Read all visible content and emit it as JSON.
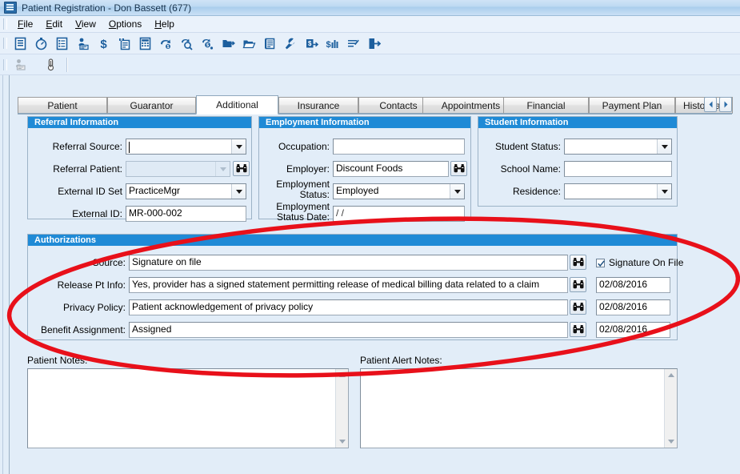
{
  "window": {
    "title": "Patient Registration - Don Bassett (677)",
    "icon": "app-window-icon"
  },
  "menu": {
    "items": [
      {
        "label": "File",
        "accel": "F"
      },
      {
        "label": "Edit",
        "accel": "E"
      },
      {
        "label": "View",
        "accel": "V"
      },
      {
        "label": "Options",
        "accel": "O"
      },
      {
        "label": "Help",
        "accel": "H"
      }
    ]
  },
  "toolbar_primary": {
    "buttons": [
      {
        "icon": "list-document-icon",
        "name": "patient-registration"
      },
      {
        "icon": "stopwatch-icon",
        "name": "timer"
      },
      {
        "icon": "checklist-icon",
        "name": "checklist"
      },
      {
        "icon": "patient-card-icon",
        "name": "patient-card"
      },
      {
        "icon": "dollar-icon",
        "name": "charges"
      },
      {
        "icon": "payment-document-icon",
        "name": "payments"
      },
      {
        "icon": "calculator-icon",
        "name": "calculator"
      },
      {
        "icon": "claim-arrow-icon",
        "name": "claims"
      },
      {
        "icon": "claim-search-icon",
        "name": "claim-search"
      },
      {
        "icon": "refund-icon",
        "name": "refund"
      },
      {
        "icon": "folder-out-icon",
        "name": "export-folder"
      },
      {
        "icon": "folder-open-icon",
        "name": "open-folder"
      },
      {
        "icon": "statement-icon",
        "name": "statement"
      },
      {
        "icon": "wrench-icon",
        "name": "tools"
      },
      {
        "icon": "transfer-balance-icon",
        "name": "transfer-balance"
      },
      {
        "icon": "dollar-chart-icon",
        "name": "reports"
      },
      {
        "icon": "edit-list-icon",
        "name": "edit-list"
      },
      {
        "icon": "exit-icon",
        "name": "exit"
      }
    ]
  },
  "toolbar_secondary": {
    "buttons": [
      {
        "icon": "patient-card-disabled-icon",
        "name": "patient-card-disabled"
      },
      {
        "icon": "thermometer-icon",
        "name": "vitals"
      }
    ]
  },
  "tabs": {
    "items": [
      {
        "label": "Patient",
        "active": false
      },
      {
        "label": "Guarantor",
        "active": false
      },
      {
        "label": "Additional",
        "active": true
      },
      {
        "label": "Insurance",
        "active": false
      },
      {
        "label": "Contacts",
        "active": false
      },
      {
        "label": "Appointments",
        "active": false
      },
      {
        "label": "Financial",
        "active": false
      },
      {
        "label": "Payment Plan",
        "active": false
      },
      {
        "label": "Historical D",
        "active": false
      }
    ],
    "nav_prev": "scroll-tabs-left",
    "nav_next": "scroll-tabs-right"
  },
  "referral_information": {
    "title": "Referral Information",
    "fields": {
      "referral_source": {
        "label": "Referral Source:",
        "value": "",
        "type": "combo"
      },
      "referral_patient": {
        "label": "Referral Patient:",
        "value": "",
        "type": "combo-disabled"
      },
      "external_id_set": {
        "label": "External ID Set",
        "value": "PracticeMgr",
        "type": "combo"
      },
      "external_id": {
        "label": "External ID:",
        "value": "MR-000-002",
        "type": "text"
      }
    }
  },
  "employment_information": {
    "title": "Employment Information",
    "fields": {
      "occupation": {
        "label": "Occupation:",
        "value": "",
        "type": "text"
      },
      "employer": {
        "label": "Employer:",
        "value": "Discount Foods",
        "type": "text-lookup"
      },
      "employment_status": {
        "label": "Employment Status:",
        "value": "Employed",
        "type": "combo"
      },
      "employment_status_date": {
        "label": "Employment Status Date:",
        "value": "  /  /",
        "type": "text"
      }
    }
  },
  "student_information": {
    "title": "Student Information",
    "fields": {
      "student_status": {
        "label": "Student Status:",
        "value": "",
        "type": "combo"
      },
      "school_name": {
        "label": "School Name:",
        "value": "",
        "type": "text"
      },
      "residence": {
        "label": "Residence:",
        "value": "",
        "type": "combo"
      }
    }
  },
  "authorizations": {
    "title": "Authorizations",
    "signature_on_file": {
      "label": "Signature On File",
      "checked": true
    },
    "rows": [
      {
        "label": "Source:",
        "value": "Signature on file",
        "lookup": "binoculars-icon",
        "date": null
      },
      {
        "label": "Release Pt Info:",
        "value": "Yes, provider has a signed statement permitting release of medical billing data related to a claim",
        "lookup": "binoculars-icon",
        "date": "02/08/2016"
      },
      {
        "label": "Privacy Policy:",
        "value": "Patient acknowledgement of privacy policy",
        "lookup": "binoculars-icon",
        "date": "02/08/2016"
      },
      {
        "label": "Benefit Assignment:",
        "value": "Assigned",
        "lookup": "binoculars-icon",
        "date": "02/08/2016"
      }
    ]
  },
  "patient_notes": {
    "label": "Patient Notes:",
    "value": ""
  },
  "patient_alert_notes": {
    "label": "Patient Alert Notes:",
    "value": ""
  },
  "annotation": {
    "shape": "ellipse",
    "color": "#e8101a",
    "target": "authorizations"
  },
  "colors": {
    "group_header": "#1f8ad6",
    "background": "#e2edf8",
    "annotation_red": "#e8101a",
    "titlebar": "#bcd9f2"
  }
}
